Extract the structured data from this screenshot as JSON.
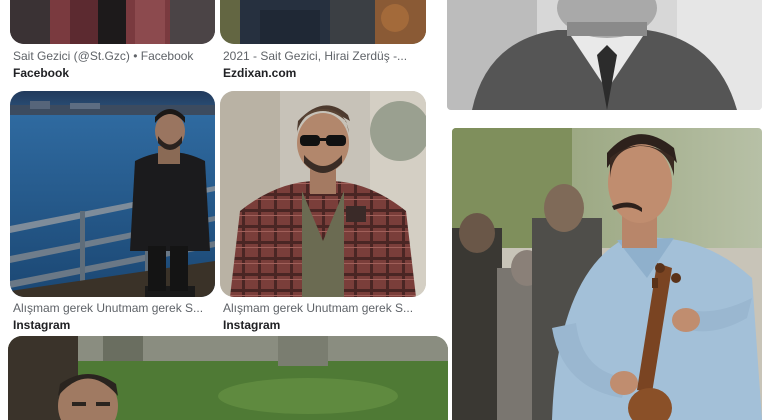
{
  "results": [
    {
      "caption": "Sait Gezici (@St.Gzc) • Facebook",
      "source": "Facebook"
    },
    {
      "caption": "2021 - Sait Gezici, Hirai Zerdüş -...",
      "source": "Ezdixan.com"
    },
    {
      "caption": "Alışmam gerek Unutmam gerek S...",
      "source": "Instagram"
    },
    {
      "caption": "Alışmam gerek Unutmam gerek S...",
      "source": "Instagram"
    }
  ],
  "colors": {
    "caption": "#5f6368",
    "source": "#202124"
  }
}
